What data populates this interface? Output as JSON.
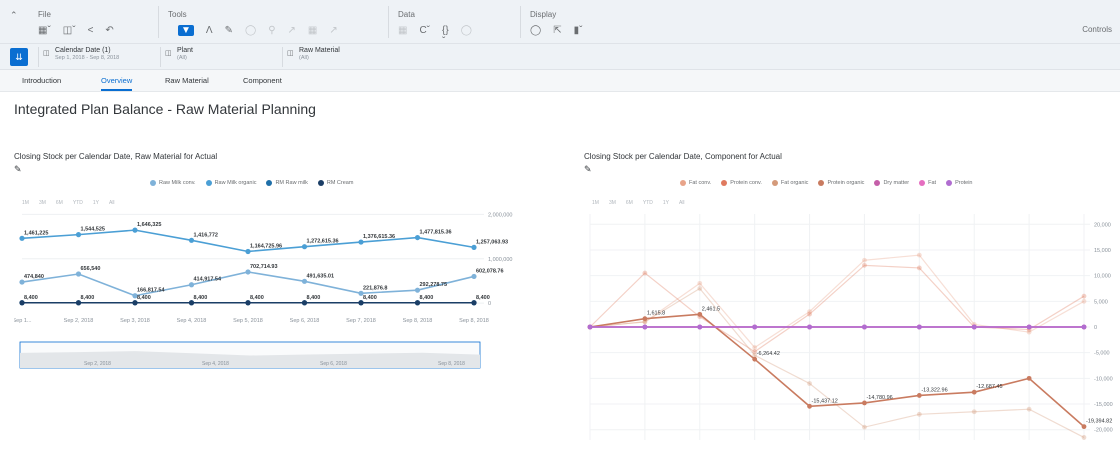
{
  "toolbar": {
    "file": {
      "title": "File"
    },
    "tools": {
      "title": "Tools"
    },
    "data": {
      "title": "Data"
    },
    "display": {
      "title": "Display"
    },
    "controls": "Controls"
  },
  "filters": [
    {
      "label": "Calendar Date (1)",
      "sub": "Sep 1, 2018 - Sep 8, 2018"
    },
    {
      "label": "Plant",
      "sub": "(All)"
    },
    {
      "label": "Raw Material",
      "sub": "(All)"
    }
  ],
  "tabs": [
    "Introduction",
    "Overview",
    "Raw Material",
    "Component"
  ],
  "active_tab": "Overview",
  "page_title": "Integrated Plan Balance - Raw Material Planning",
  "range_buttons": [
    "1M",
    "3M",
    "6M",
    "YTD",
    "1Y",
    "All"
  ],
  "colors": {
    "accent": "#0a6ed1",
    "rm1": "#7fb2d9",
    "rm2": "#4b9fd5",
    "rm3": "#1f6fa8",
    "rm4": "#1b3e66"
  },
  "chart_data": [
    {
      "type": "line",
      "title": "Closing Stock per Calendar Date, Raw Material for Actual",
      "categories": [
        "Sep 1...",
        "Sep 2, 2018",
        "Sep 3, 2018",
        "Sep 4, 2018",
        "Sep 5, 2018",
        "Sep 6, 2018",
        "Sep 7, 2018",
        "Sep 8, 2018",
        "Sep 8, 2018"
      ],
      "ylim": [
        -200000,
        2100000
      ],
      "yticks": [
        {
          "v": 2000000,
          "label": "2,000,000"
        },
        {
          "v": 1000000,
          "label": "1,000,000"
        },
        {
          "v": 0,
          "label": "0"
        }
      ],
      "navigator_labels": [
        "Sep 2, 2018",
        "Sep 4, 2018",
        "Sep 6, 2018",
        "Sep 8, 2018"
      ],
      "series": [
        {
          "name": "Raw Milk conv.",
          "color": "#7fb2d9",
          "values": [
            474840,
            656540,
            166817.54,
            414917.54,
            702714.93,
            491635.01,
            221876.8,
            292278.75,
            602078.76
          ],
          "labels": [
            "474,840",
            "656,540",
            "166,817.54",
            "414,917.54",
            "702,714.93",
            "491,635.01",
            "221,876.8",
            "292,278.75",
            "602,078.76"
          ]
        },
        {
          "name": "Raw Milk organic",
          "color": "#4b9fd5",
          "values": [
            1461225,
            1544525,
            1646325,
            1416772,
            1164725.96,
            1272615.36,
            1376615.36,
            1477815.36,
            1257063.93
          ],
          "labels": [
            "1,461,225",
            "1,544,525",
            "1,646,325",
            "1,416,772",
            "1,164,725.96",
            "1,272,615.36",
            "1,376,615.36",
            "1,477,815.36",
            "1,257,063.93"
          ]
        },
        {
          "name": "RM Raw milk",
          "color": "#1f6fa8",
          "values": [
            8400,
            8400,
            8400,
            8400,
            8400,
            8400,
            8400,
            8400,
            8400
          ],
          "labels": []
        },
        {
          "name": "RM Cream",
          "color": "#1b3e66",
          "values": [
            8400,
            8400,
            8400,
            8400,
            8400,
            8400,
            8400,
            8400,
            8400
          ],
          "labels": [
            "8,400",
            "8,400",
            "8,400",
            "8,400",
            "8,400",
            "8,400",
            "8,400",
            "8,400",
            "8,400"
          ]
        }
      ]
    },
    {
      "type": "line",
      "title": "Closing Stock per Calendar Date, Component for Actual",
      "ylim": [
        -22000,
        22000
      ],
      "yticks": [
        {
          "v": 20000,
          "label": "20,000"
        },
        {
          "v": 15000,
          "label": "15,000"
        },
        {
          "v": 10000,
          "label": "10,000"
        },
        {
          "v": 5000,
          "label": "5,000"
        },
        {
          "v": 0,
          "label": "0"
        },
        {
          "v": -5000,
          "label": "-5,000"
        },
        {
          "v": -10000,
          "label": "-10,000"
        },
        {
          "v": -15000,
          "label": "-15,000"
        },
        {
          "v": -20000,
          "label": "-20,000"
        }
      ],
      "series": [
        {
          "name": "Fat conv.",
          "color": "#e8a48a",
          "values": [
            0,
            1000,
            8500,
            -4000,
            3000,
            13000,
            14000,
            500,
            -1000,
            5000
          ],
          "labels": []
        },
        {
          "name": "Protein conv.",
          "color": "#e07a5f",
          "values": [
            0,
            10500,
            2000,
            -4800,
            2500,
            12000,
            11500,
            0,
            -500,
            6000
          ],
          "labels": []
        },
        {
          "name": "Fat organic",
          "color": "#d49a7a",
          "values": [
            0,
            1000,
            7500,
            -5500,
            -11000,
            -19500,
            -17000,
            -16500,
            -16000,
            -21500
          ],
          "labels": []
        },
        {
          "name": "Protein organic",
          "color": "#c97b60",
          "values": [
            0,
            1615.8,
            2461.5,
            -6264.42,
            -15437.12,
            -14780.96,
            -13322.96,
            -12687.45,
            -10000,
            -19394.82
          ],
          "labels": [
            "",
            "1,615.8",
            "2,461.5",
            "-6,264.42",
            "-15,437.12",
            "-14,780.96",
            "-13,322.96",
            "-12,687.45",
            "",
            "-19,394.82"
          ]
        },
        {
          "name": "Dry matter",
          "color": "#c55fa9",
          "values": [
            0,
            0,
            0,
            0,
            0,
            0,
            0,
            0,
            0,
            0
          ],
          "labels": []
        },
        {
          "name": "Fat",
          "color": "#e56ec0",
          "values": [
            0,
            0,
            0,
            0,
            0,
            0,
            0,
            0,
            0,
            0
          ],
          "labels": []
        },
        {
          "name": "Protein",
          "color": "#b06dd0",
          "values": [
            0,
            0,
            0,
            0,
            0,
            0,
            0,
            0,
            0,
            0
          ],
          "labels": []
        }
      ]
    }
  ]
}
